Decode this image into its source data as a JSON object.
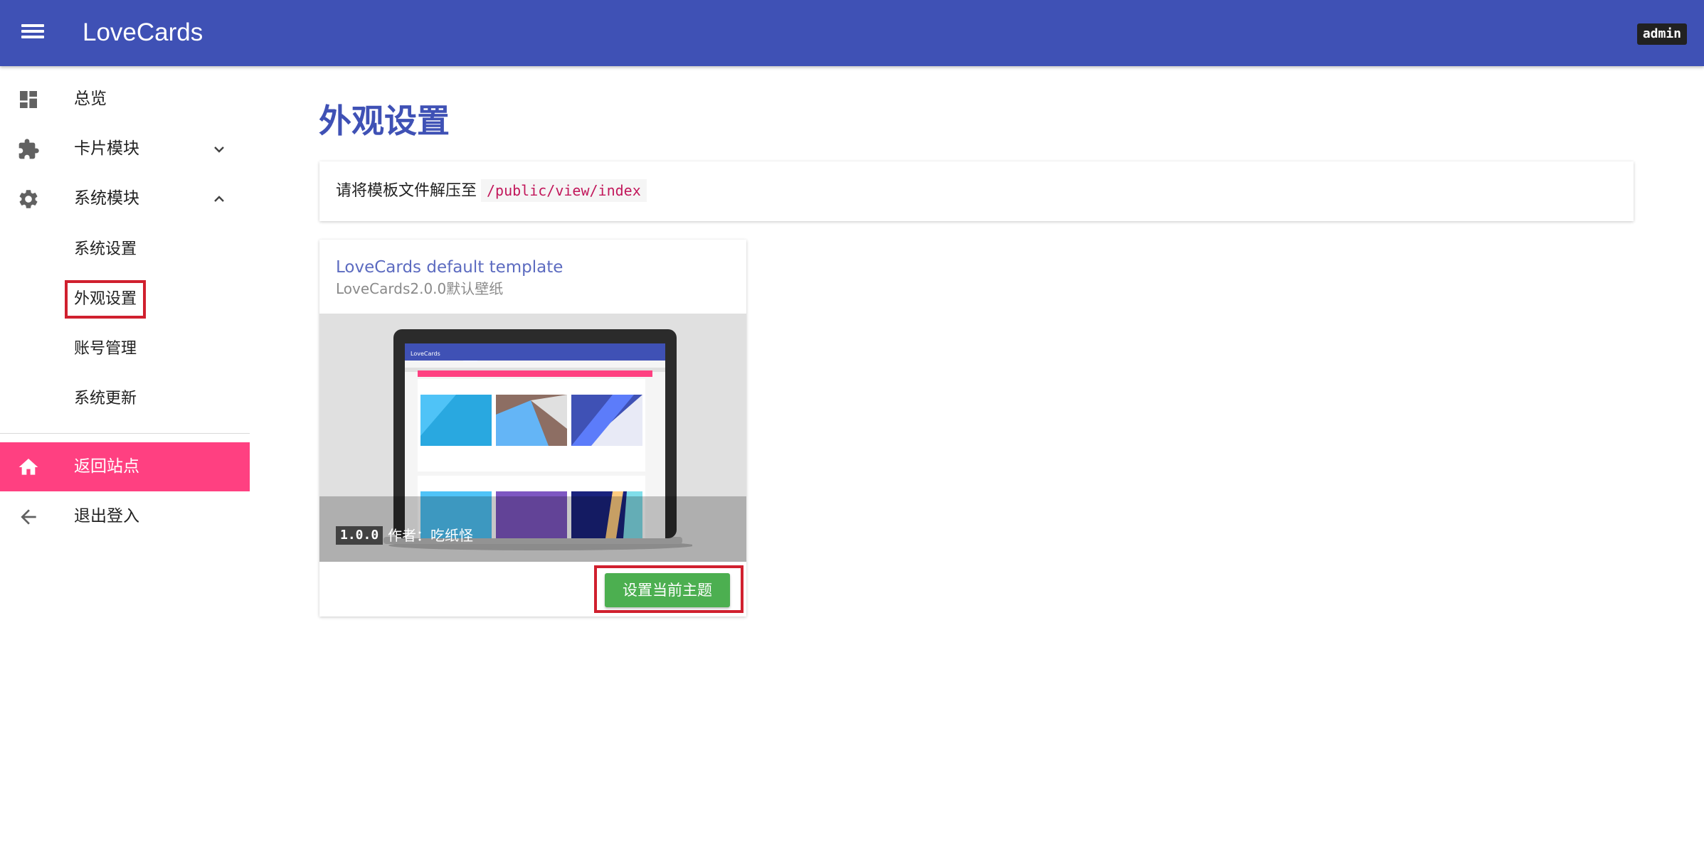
{
  "appbar": {
    "title": "LoveCards",
    "menu_icon": "menu-icon",
    "user_badge": "admin"
  },
  "sidebar": {
    "items": [
      {
        "label": "总览",
        "icon": "dashboard-icon"
      },
      {
        "label": "卡片模块",
        "icon": "puzzle-icon",
        "expand": "chevron-down-icon"
      },
      {
        "label": "系统模块",
        "icon": "gear-icon",
        "expand": "chevron-up-icon"
      }
    ],
    "subitems": [
      "系统设置",
      "外观设置",
      "账号管理",
      "系统更新"
    ],
    "active_subitem": "外观设置",
    "return": {
      "label": "返回站点",
      "icon": "home-icon"
    },
    "logout": {
      "label": "退出登入",
      "icon": "arrow-left-icon"
    }
  },
  "main": {
    "page_title": "外观设置",
    "notice_text": "请将模板文件解压至",
    "notice_path": "/public/view/index",
    "theme_card": {
      "title": "LoveCards default template",
      "subtitle": "LoveCards2.0.0默认壁纸",
      "version": "1.0.0",
      "author": "作者：吃纸怪",
      "preview_app_name": "LoveCards",
      "button_label": "设置当前主题"
    }
  },
  "colors": {
    "primary": "#3f51b5",
    "accent": "#ff4081",
    "success": "#4caf50",
    "highlight_box": "#d0202e"
  }
}
